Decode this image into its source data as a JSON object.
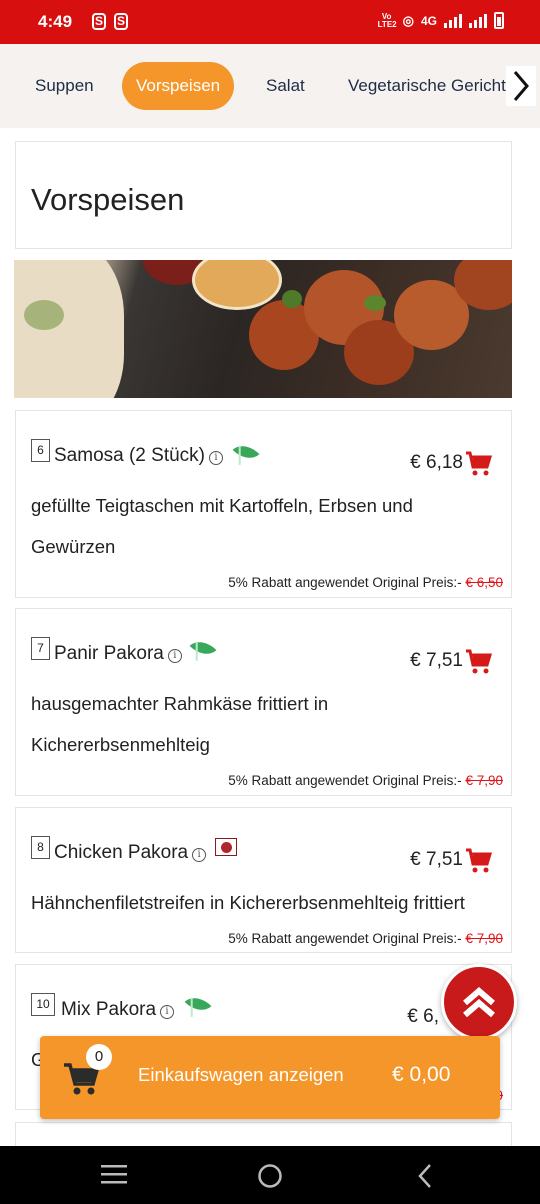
{
  "status_bar": {
    "time": "4:49",
    "network": "4G",
    "volte": "Vo LTE2"
  },
  "tabs": [
    {
      "label": "Suppen"
    },
    {
      "label": "Vorspeisen"
    },
    {
      "label": "Salat"
    },
    {
      "label": "Vegetarische Gericht"
    }
  ],
  "active_tab": "Vorspeisen",
  "section": {
    "title": "Vorspeisen"
  },
  "items": [
    {
      "number": "6",
      "name": "Samosa (2 Stück)",
      "tag": "vegetarian-leaf-icon",
      "price": "€ 6,18",
      "description": "gefüllte Teigtaschen mit Kartoffeln, Erbsen und Gewürzen",
      "discount_text": "5% Rabatt angewendet Original Preis:-",
      "original_price": "€ 6,50"
    },
    {
      "number": "7",
      "name": "Panir Pakora",
      "tag": "vegetarian-leaf-icon",
      "price": "€ 7,51",
      "description": "hausgemachter Rahmkäse frittiert in Kichererbsenmehlteig",
      "discount_text": "5% Rabatt angewendet Original Preis:-",
      "original_price": "€ 7,90"
    },
    {
      "number": "8",
      "name": "Chicken Pakora",
      "tag": "non-vegetarian-icon",
      "price": "€ 7,51",
      "description": "Hähnchenfiletstreifen in Kichererbsenmehlteig frittiert",
      "discount_text": "5% Rabatt angewendet Original Preis:-",
      "original_price": "€ 7,90"
    },
    {
      "number": "10",
      "name": "Mix Pakora",
      "tag": "vegetarian-leaf-icon",
      "price": "€ 6,",
      "description": "G",
      "discount_text": "",
      "original_price": "9"
    }
  ],
  "cart": {
    "count": "0",
    "label": "Einkaufswagen anzeigen",
    "total": "€ 0,00"
  },
  "colors": {
    "brand_red": "#d80f0f",
    "accent_orange": "#f5962a",
    "cart_red": "#d51a1a",
    "veg_green": "#3aa85a"
  },
  "icons": [
    "info-icon",
    "vegetarian-leaf-icon",
    "non-vegetarian-icon",
    "cart-icon",
    "scroll-to-top-icon",
    "chevron-right-icon"
  ]
}
